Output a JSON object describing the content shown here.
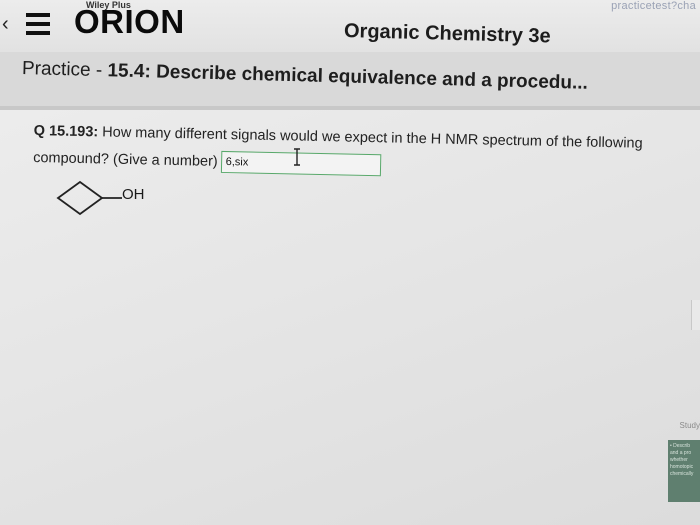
{
  "header": {
    "top_right_url": "practicetest?cha",
    "small_brand": "Wiley Plus",
    "logo": "ORION",
    "course": "Organic Chemistry 3e"
  },
  "practice": {
    "prefix": "Practice - ",
    "section": "15.4: Describe chemical equivalence and a procedu..."
  },
  "question": {
    "number": "Q 15.193:",
    "text": " How many different signals would we expect in the H NMR spectrum of the following compound? (Give a number)",
    "answer_value": "6,six",
    "structure_label": "OH"
  },
  "sidebar": {
    "study_label": "Study",
    "note_lines": [
      "• Describ",
      "and a pro",
      "whether",
      "homotopic",
      "chemically"
    ]
  }
}
